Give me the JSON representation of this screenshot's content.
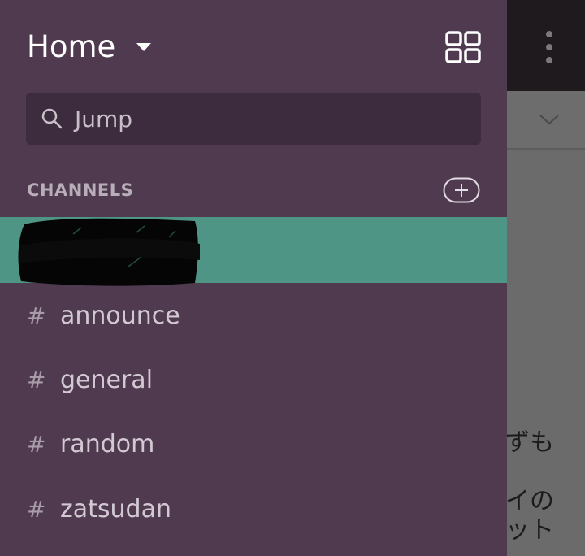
{
  "drawer": {
    "title": "Home",
    "search": {
      "placeholder": "Jump"
    },
    "channels_section_label": "CHANNELS",
    "channel_prefix": "#",
    "channels": [
      {
        "name": "announce"
      },
      {
        "name": "general"
      },
      {
        "name": "random"
      },
      {
        "name": "zatsudan"
      }
    ]
  },
  "background": {
    "text_lines": [
      "ずも",
      "イの",
      "ット"
    ]
  },
  "colors": {
    "drawer_bg": "#4f3a4f",
    "selected_channel": "#4f9586",
    "search_bg": "#3d2c3d"
  }
}
